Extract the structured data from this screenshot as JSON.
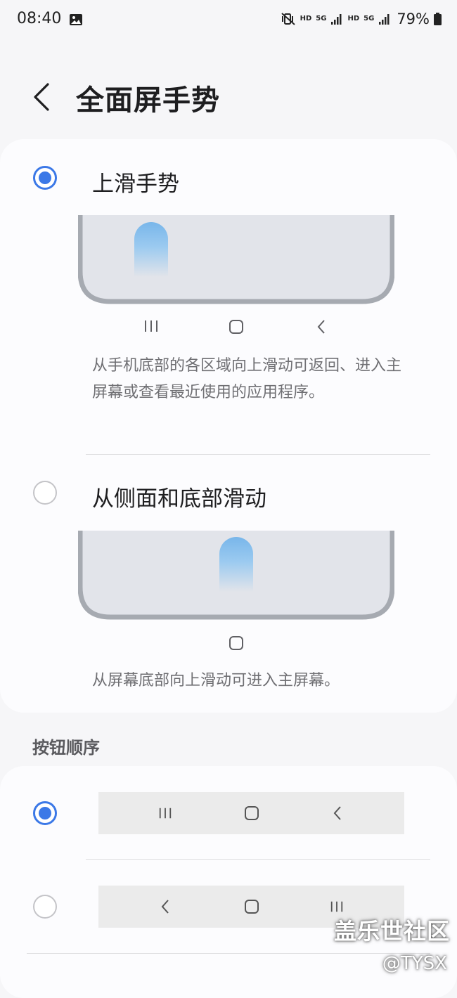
{
  "status_bar": {
    "time": "08:40",
    "hd1": "HD",
    "net1": "5G",
    "hd2": "HD",
    "net2": "5G",
    "battery": "79%"
  },
  "header": {
    "title": "全面屏手势"
  },
  "gesture_options": [
    {
      "label": "上滑手势",
      "selected": true,
      "description": "从手机底部的各区域向上滑动可返回、进入主屏幕或查看最近使用的应用程序。"
    },
    {
      "label": "从侧面和底部滑动",
      "selected": false,
      "description": "从屏幕底部向上滑动可进入主屏幕。"
    }
  ],
  "button_order": {
    "section_title": "按钮顺序",
    "options": [
      {
        "selected": true,
        "order": [
          "recents-icon",
          "home-icon",
          "back-icon"
        ]
      },
      {
        "selected": false,
        "order": [
          "back-icon",
          "home-icon",
          "recents-icon"
        ]
      }
    ]
  },
  "watermark": {
    "text": "盖乐世社区",
    "handle": "@TYSX"
  },
  "colors": {
    "accent": "#3b78e7",
    "background": "#f6f6f8",
    "card": "#fcfcfe",
    "phone_frame": "#a6aab1",
    "phone_screen": "#e2e4ea"
  }
}
